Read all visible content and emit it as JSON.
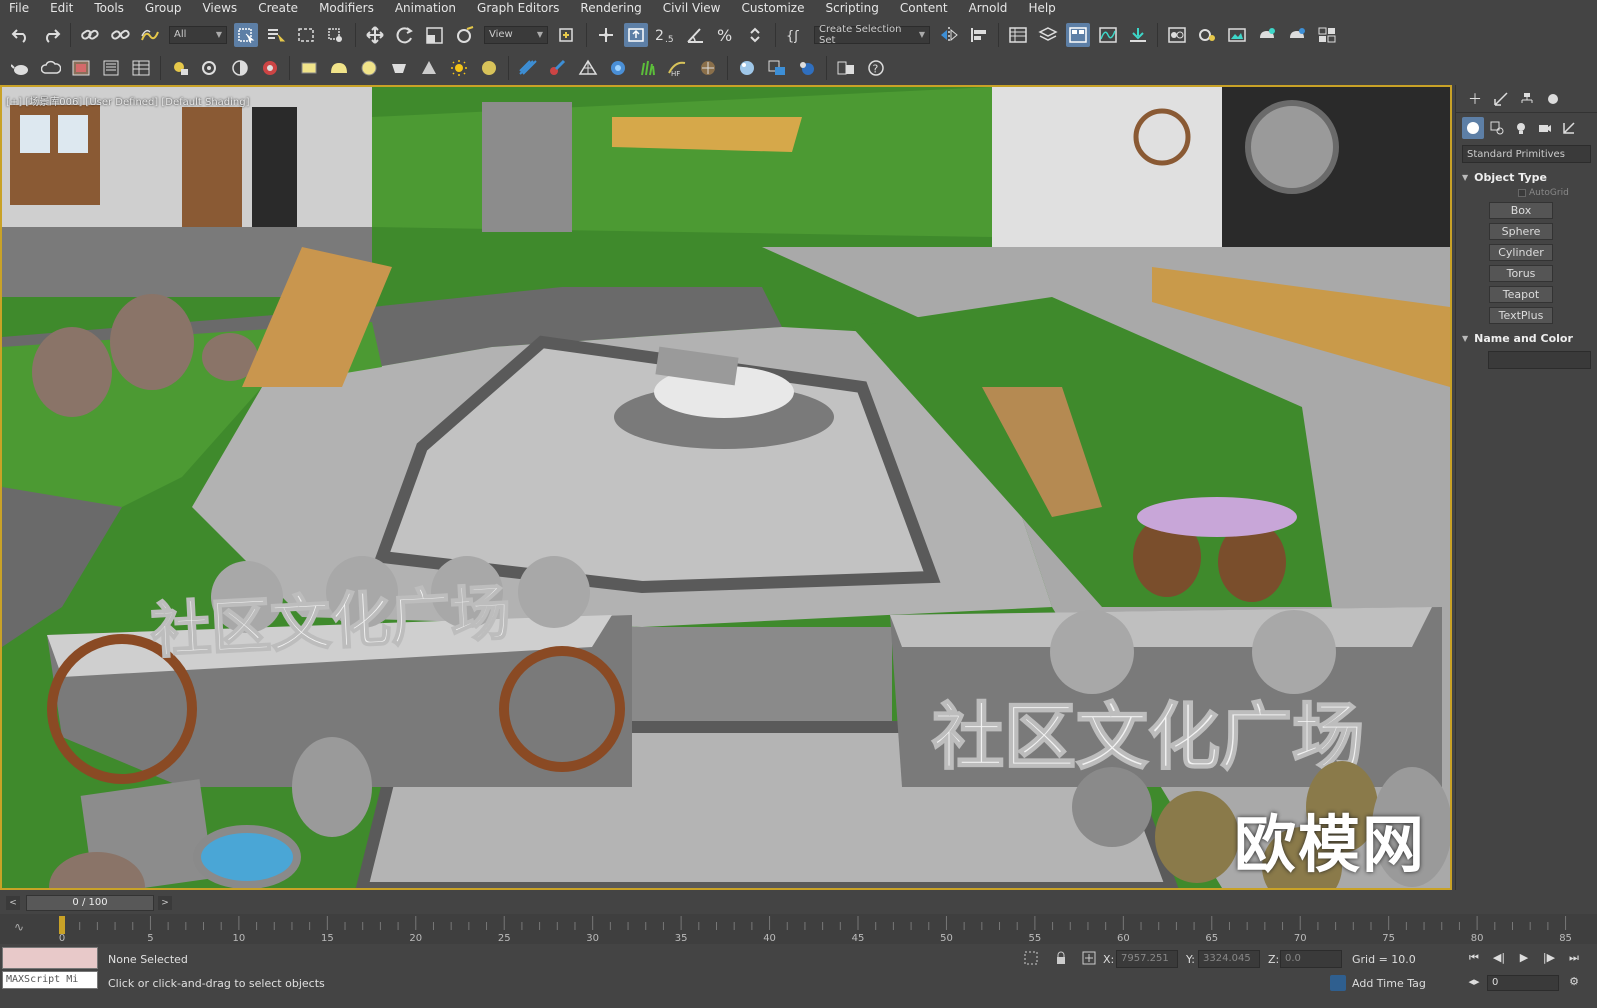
{
  "menu": [
    "File",
    "Edit",
    "Tools",
    "Group",
    "Views",
    "Create",
    "Modifiers",
    "Animation",
    "Graph Editors",
    "Rendering",
    "Civil View",
    "Customize",
    "Scripting",
    "Content",
    "Arnold",
    "Help"
  ],
  "toolbar": {
    "selection_filter": "All",
    "reference_coord": "View",
    "named_selection": "Create Selection Set"
  },
  "viewport": {
    "label": "[+] [场景库006] [User Defined] [Default Shading]",
    "sign_text": "社区文化广场",
    "brand_watermark": "欧模网"
  },
  "command_panel": {
    "category": "Standard Primitives",
    "object_type_title": "Object Type",
    "autogrid_label": "AutoGrid",
    "primitives": [
      "Box",
      "Sphere",
      "Cylinder",
      "Torus",
      "Teapot",
      "TextPlus"
    ],
    "name_color_title": "Name and Color"
  },
  "timeslider": {
    "frame_display": "0 / 100",
    "ticks": [
      "0",
      "5",
      "10",
      "15",
      "20",
      "25",
      "30",
      "35",
      "40",
      "45",
      "50",
      "55",
      "60",
      "65",
      "70",
      "75",
      "80",
      "85"
    ]
  },
  "status": {
    "maxscript_label": "MAXScript Mi",
    "selection": "None Selected",
    "prompt": "Click or click-and-drag to select objects",
    "x_label": "X:",
    "x_value": "7957.251",
    "y_label": "Y:",
    "y_value": "3324.045",
    "z_label": "Z:",
    "z_value": "0.0",
    "grid": "Grid = 10.0",
    "add_time_tag": "Add Time Tag",
    "current_frame": "0"
  },
  "colors": {
    "viewport_border": "#c9a227",
    "active_button": "#5d7fa6",
    "grass": "#3e8a2a",
    "paving": "#a8a8a8"
  }
}
